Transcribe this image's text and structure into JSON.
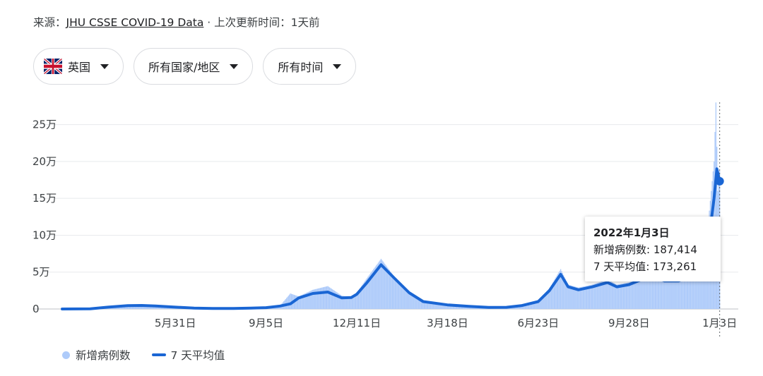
{
  "header": {
    "source_prefix": "来源：",
    "source_link": "JHU CSSE COVID-19 Data",
    "updated": " · 上次更新时间：1天前"
  },
  "filters": {
    "country": "英国",
    "region": "所有国家/地区",
    "period": "所有时间"
  },
  "legend": {
    "daily": "新增病例数",
    "avg": "7 天平均值"
  },
  "tooltip": {
    "date": "2022年1月3日",
    "daily_label": "新增病例数",
    "daily_value": "187,414",
    "avg_label": "7 天平均值",
    "avg_value": "173,261"
  },
  "colors": {
    "bars": "#aecbfa",
    "line": "#1a66d4",
    "grid": "#e8eaed"
  },
  "chart_data": {
    "type": "bar",
    "title": "",
    "xlabel": "",
    "ylabel": "",
    "ylim": [
      0,
      285000
    ],
    "yticks": [
      0,
      50000,
      100000,
      150000,
      200000,
      250000
    ],
    "ytick_labels": [
      "0",
      "5万",
      "10万",
      "15万",
      "20万",
      "25万"
    ],
    "xlim": [
      "2020-01-31",
      "2022-01-04"
    ],
    "xticks": [
      "2020-05-31",
      "2020-09-05",
      "2020-12-11",
      "2021-03-18",
      "2021-06-23",
      "2021-09-28",
      "2022-01-03"
    ],
    "xtick_labels": [
      "5月31日",
      "9月5日",
      "12月11日",
      "3月18日",
      "6月23日",
      "9月28日",
      "1月3日"
    ],
    "highlight": {
      "date": "2022-01-03",
      "daily": 187414,
      "avg": 173261
    },
    "series": [
      {
        "name": "7 天平均值",
        "kind": "line",
        "points": [
          [
            "2020-01-31",
            0
          ],
          [
            "2020-03-01",
            200
          ],
          [
            "2020-03-20",
            2500
          ],
          [
            "2020-04-10",
            4500
          ],
          [
            "2020-04-25",
            4800
          ],
          [
            "2020-05-10",
            4000
          ],
          [
            "2020-05-31",
            2500
          ],
          [
            "2020-06-20",
            1200
          ],
          [
            "2020-07-10",
            700
          ],
          [
            "2020-08-01",
            800
          ],
          [
            "2020-08-20",
            1100
          ],
          [
            "2020-09-05",
            1800
          ],
          [
            "2020-09-20",
            4000
          ],
          [
            "2020-10-01",
            7000
          ],
          [
            "2020-10-10",
            15000
          ],
          [
            "2020-10-25",
            21000
          ],
          [
            "2020-11-10",
            23000
          ],
          [
            "2020-11-25",
            15000
          ],
          [
            "2020-12-05",
            15500
          ],
          [
            "2020-12-11",
            20000
          ],
          [
            "2020-12-22",
            36000
          ],
          [
            "2021-01-06",
            60000
          ],
          [
            "2021-01-20",
            42000
          ],
          [
            "2021-02-05",
            22000
          ],
          [
            "2021-02-20",
            10000
          ],
          [
            "2021-03-18",
            5500
          ],
          [
            "2021-04-10",
            3500
          ],
          [
            "2021-05-01",
            2200
          ],
          [
            "2021-05-20",
            2300
          ],
          [
            "2021-06-05",
            4500
          ],
          [
            "2021-06-23",
            10000
          ],
          [
            "2021-07-05",
            25000
          ],
          [
            "2021-07-17",
            47000
          ],
          [
            "2021-07-25",
            30000
          ],
          [
            "2021-08-05",
            26000
          ],
          [
            "2021-08-20",
            30000
          ],
          [
            "2021-09-05",
            36000
          ],
          [
            "2021-09-15",
            30000
          ],
          [
            "2021-09-28",
            33000
          ],
          [
            "2021-10-10",
            39000
          ],
          [
            "2021-10-21",
            45000
          ],
          [
            "2021-11-05",
            38000
          ],
          [
            "2021-11-20",
            38000
          ],
          [
            "2021-12-05",
            45000
          ],
          [
            "2021-12-15",
            60000
          ],
          [
            "2021-12-22",
            90000
          ],
          [
            "2021-12-28",
            150000
          ],
          [
            "2021-12-31",
            190000
          ],
          [
            "2022-01-03",
            173261
          ]
        ]
      },
      {
        "name": "新增病例数",
        "kind": "bar",
        "points": [
          [
            "2020-01-31",
            0
          ],
          [
            "2020-03-01",
            300
          ],
          [
            "2020-03-20",
            3500
          ],
          [
            "2020-04-10",
            6000
          ],
          [
            "2020-04-25",
            5500
          ],
          [
            "2020-05-10",
            4500
          ],
          [
            "2020-05-31",
            2800
          ],
          [
            "2020-06-20",
            1400
          ],
          [
            "2020-07-10",
            800
          ],
          [
            "2020-08-01",
            900
          ],
          [
            "2020-08-20",
            1300
          ],
          [
            "2020-09-05",
            2400
          ],
          [
            "2020-09-20",
            4500
          ],
          [
            "2020-10-01",
            21000
          ],
          [
            "2020-10-10",
            17000
          ],
          [
            "2020-10-25",
            26000
          ],
          [
            "2020-11-10",
            31000
          ],
          [
            "2020-11-25",
            18000
          ],
          [
            "2020-12-05",
            16000
          ],
          [
            "2020-12-11",
            22000
          ],
          [
            "2020-12-22",
            42000
          ],
          [
            "2021-01-06",
            68000
          ],
          [
            "2021-01-20",
            44000
          ],
          [
            "2021-02-05",
            24000
          ],
          [
            "2021-02-20",
            11000
          ],
          [
            "2021-03-18",
            6000
          ],
          [
            "2021-04-10",
            3800
          ],
          [
            "2021-05-01",
            2500
          ],
          [
            "2021-05-20",
            2600
          ],
          [
            "2021-06-05",
            5500
          ],
          [
            "2021-06-23",
            12000
          ],
          [
            "2021-07-05",
            28000
          ],
          [
            "2021-07-17",
            54000
          ],
          [
            "2021-07-25",
            33000
          ],
          [
            "2021-08-05",
            29000
          ],
          [
            "2021-08-20",
            33000
          ],
          [
            "2021-09-05",
            40000
          ],
          [
            "2021-09-15",
            33000
          ],
          [
            "2021-09-28",
            36000
          ],
          [
            "2021-10-10",
            43000
          ],
          [
            "2021-10-21",
            52000
          ],
          [
            "2021-11-05",
            41000
          ],
          [
            "2021-11-20",
            42000
          ],
          [
            "2021-12-05",
            50000
          ],
          [
            "2021-12-15",
            78000
          ],
          [
            "2021-12-22",
            120000
          ],
          [
            "2021-12-28",
            200000
          ],
          [
            "2021-12-30",
            280000
          ],
          [
            "2021-12-31",
            220000
          ],
          [
            "2022-01-01",
            160000
          ],
          [
            "2022-01-03",
            187414
          ]
        ]
      }
    ]
  }
}
